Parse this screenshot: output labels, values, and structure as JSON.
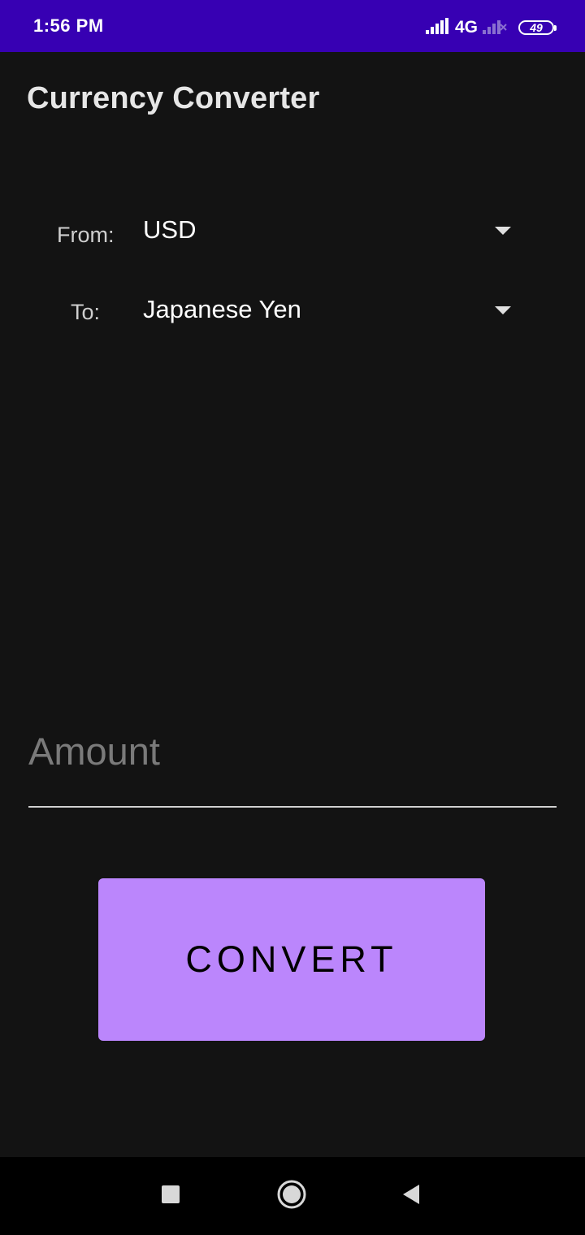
{
  "status_bar": {
    "time": "1:56 PM",
    "network": "4G",
    "battery": "49",
    "colors": {
      "background": "#3700b3"
    }
  },
  "app_bar": {
    "title": "Currency Converter"
  },
  "from": {
    "label": "From:",
    "selected": "USD"
  },
  "to": {
    "label": "To:",
    "selected": "Japanese Yen"
  },
  "amount": {
    "placeholder": "Amount",
    "value": ""
  },
  "convert_button": {
    "label": "CONVERT",
    "color": "#bb86fc"
  },
  "nav_bar": {
    "icons": [
      "recents-square-icon",
      "home-circle-icon",
      "back-triangle-icon"
    ]
  }
}
